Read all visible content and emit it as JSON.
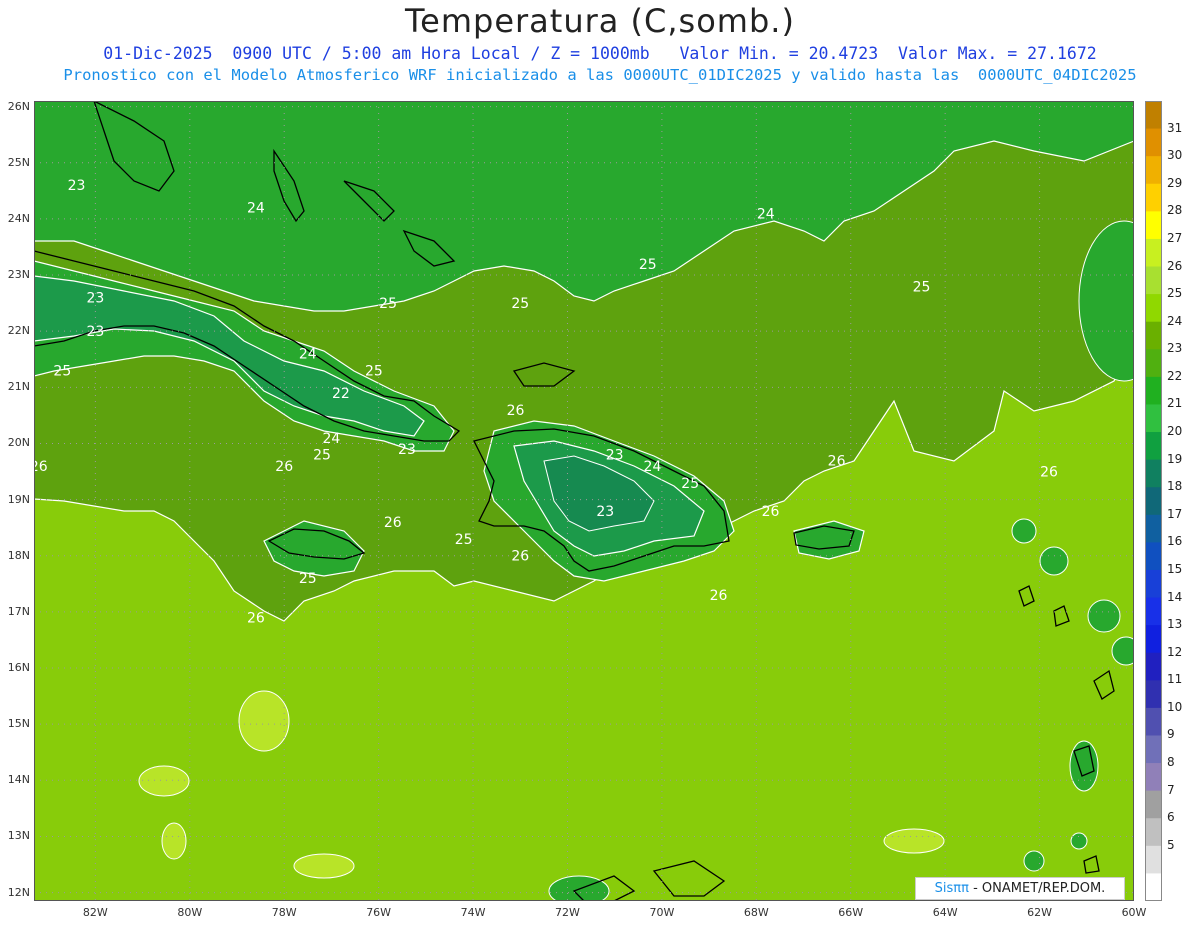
{
  "header": {
    "title": "Temperatura (C,somb.)",
    "subtitle1": "01-Dic-2025  0900 UTC / 5:00 am Hora Local / Z = 1000mb   Valor Min. = 20.4723  Valor Max. = 27.1672",
    "subtitle2": "Pronostico con el Modelo Atmosferico WRF inicializado a las 0000UTC_01DIC2025 y valido hasta las  0000UTC_04DIC2025"
  },
  "map": {
    "lat_labels": [
      "26N",
      "25N",
      "24N",
      "23N",
      "22N",
      "21N",
      "20N",
      "19N",
      "18N",
      "17N",
      "16N",
      "15N",
      "14N",
      "13N",
      "12N"
    ],
    "lon_labels": [
      "82W",
      "80W",
      "78W",
      "76W",
      "74W",
      "72W",
      "70W",
      "68W",
      "66W",
      "64W",
      "62W",
      "60W"
    ],
    "contour_labels": [
      {
        "text": "23",
        "lat": 24.6,
        "lon": -82.4
      },
      {
        "text": "24",
        "lat": 24.2,
        "lon": -78.6
      },
      {
        "text": "24",
        "lat": 24.1,
        "lon": -67.8
      },
      {
        "text": "25",
        "lat": 23.2,
        "lon": -70.3
      },
      {
        "text": "25",
        "lat": 22.8,
        "lon": -64.5
      },
      {
        "text": "23",
        "lat": 22.6,
        "lon": -82.0
      },
      {
        "text": "25",
        "lat": 22.5,
        "lon": -75.8
      },
      {
        "text": "25",
        "lat": 22.5,
        "lon": -73.0
      },
      {
        "text": "23",
        "lat": 22.0,
        "lon": -82.0
      },
      {
        "text": "24",
        "lat": 21.6,
        "lon": -77.5
      },
      {
        "text": "25",
        "lat": 21.3,
        "lon": -82.7
      },
      {
        "text": "25",
        "lat": 21.3,
        "lon": -76.1
      },
      {
        "text": "22",
        "lat": 20.9,
        "lon": -76.8
      },
      {
        "text": "26",
        "lat": 20.6,
        "lon": -73.1
      },
      {
        "text": "24",
        "lat": 20.1,
        "lon": -77.0
      },
      {
        "text": "25",
        "lat": 19.8,
        "lon": -77.2
      },
      {
        "text": "23",
        "lat": 19.9,
        "lon": -75.4
      },
      {
        "text": "23",
        "lat": 19.8,
        "lon": -71.0
      },
      {
        "text": "24",
        "lat": 19.6,
        "lon": -70.2
      },
      {
        "text": "26",
        "lat": 19.6,
        "lon": -83.2
      },
      {
        "text": "26",
        "lat": 19.6,
        "lon": -78.0
      },
      {
        "text": "25",
        "lat": 19.3,
        "lon": -69.4
      },
      {
        "text": "26",
        "lat": 19.7,
        "lon": -66.3
      },
      {
        "text": "26",
        "lat": 19.5,
        "lon": -61.8
      },
      {
        "text": "23",
        "lat": 18.8,
        "lon": -71.2
      },
      {
        "text": "26",
        "lat": 18.8,
        "lon": -67.7
      },
      {
        "text": "26",
        "lat": 18.6,
        "lon": -75.7
      },
      {
        "text": "25",
        "lat": 18.3,
        "lon": -74.2
      },
      {
        "text": "26",
        "lat": 18.0,
        "lon": -73.0
      },
      {
        "text": "25",
        "lat": 17.6,
        "lon": -77.5
      },
      {
        "text": "26",
        "lat": 17.3,
        "lon": -68.8
      },
      {
        "text": "26",
        "lat": 16.9,
        "lon": -78.6
      }
    ]
  },
  "colorbar": {
    "labels": [
      "31",
      "30",
      "29",
      "28",
      "27",
      "26",
      "25",
      "24",
      "23",
      "22",
      "21",
      "20",
      "19",
      "18",
      "17",
      "16",
      "15",
      "14",
      "13",
      "12",
      "11",
      "10",
      "9",
      "8",
      "7",
      "6",
      "5"
    ],
    "colors": [
      "#c08000",
      "#e09000",
      "#f0b000",
      "#ffd000",
      "#ffff00",
      "#c8f020",
      "#a8e030",
      "#90d800",
      "#6ab000",
      "#50b010",
      "#20b020",
      "#30c040",
      "#10a040",
      "#108060",
      "#106878",
      "#1060a0",
      "#1050c0",
      "#1840d8",
      "#1830e8",
      "#1020e0",
      "#2020c0",
      "#3030b0",
      "#5050b0",
      "#7070b8",
      "#9080b8",
      "#a0a0a0",
      "#c0c0c0",
      "#e0e0e0",
      "#ffffff"
    ]
  },
  "footer": {
    "brand": "Sisππ",
    "credit": "- ONAMET/REP.DOM."
  },
  "colors": {
    "temp_22": "#168a50",
    "temp_23": "#1c9a4a",
    "temp_24": "#28a82e",
    "temp_25": "#5ea20e",
    "temp_26": "#88cc0a",
    "temp_27": "#b8e428",
    "coast": "#000000",
    "contour": "#ffffff",
    "grid": "#9a9a9a"
  }
}
